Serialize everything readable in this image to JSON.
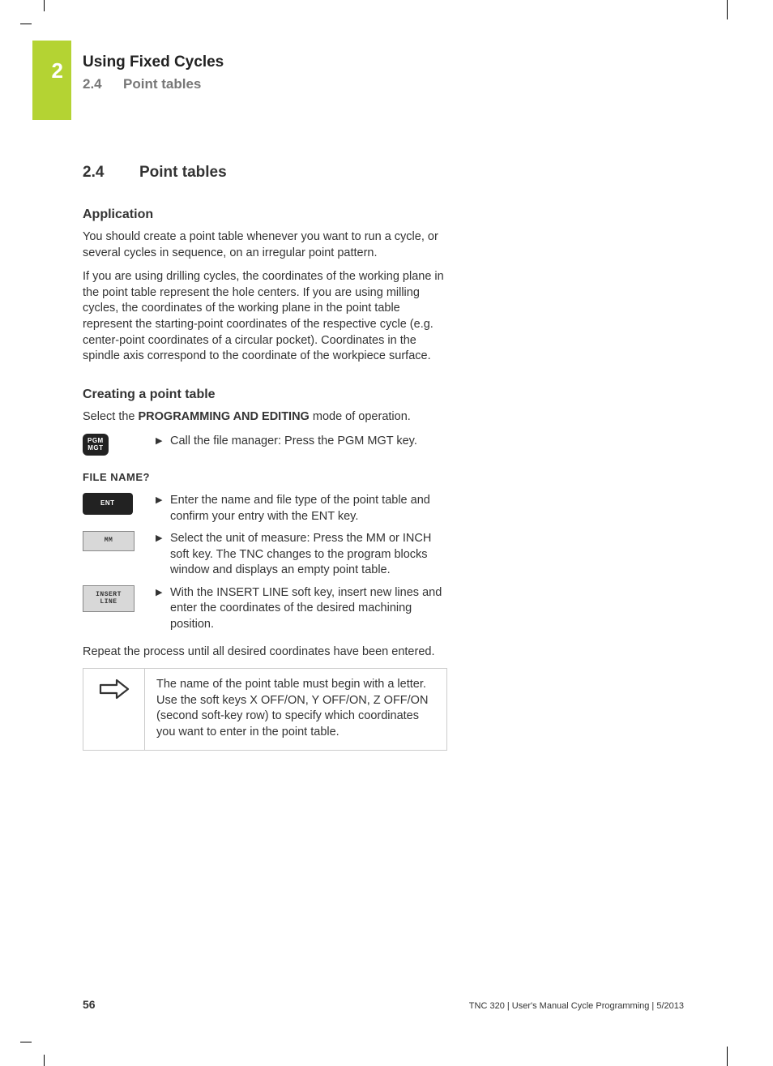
{
  "chapter": {
    "number": "2",
    "title": "Using Fixed Cycles"
  },
  "section_header": {
    "number": "2.4",
    "title": "Point tables"
  },
  "main_heading": {
    "number": "2.4",
    "title": "Point tables"
  },
  "application": {
    "heading": "Application",
    "p1": "You should create a point table whenever you want to run a cycle, or several cycles in sequence, on an irregular point pattern.",
    "p2": "If you are using drilling cycles, the coordinates of the working plane in the point table represent the hole centers. If you are using milling cycles, the coordinates of the working plane in the point table represent the starting-point coordinates of the respective cycle (e.g. center-point coordinates of a circular pocket). Coordinates in the spindle axis correspond to the coordinate of the workpiece surface."
  },
  "creating": {
    "heading": "Creating a point table",
    "intro_pre": "Select the ",
    "intro_bold": "PROGRAMMING AND EDITING",
    "intro_post": " mode of operation.",
    "step1": "Call the file manager: Press the PGM MGT key.",
    "prompt": "FILE NAME?",
    "step2": "Enter the name and file type of the point table and confirm your entry with the ENT key.",
    "step3": "Select the unit of measure: Press the MM or INCH soft key. The TNC changes to the program blocks window and displays an empty point table.",
    "step4": "With the INSERT LINE soft key, insert new lines and enter the coordinates of the desired machining position.",
    "repeat": "Repeat the process until all desired coordinates have been entered.",
    "note": "The name of the point table must begin with a letter. Use the soft keys X OFF/ON, Y OFF/ON, Z OFF/ON (second soft-key row) to specify which coordinates you want to enter in the point table."
  },
  "keys": {
    "pgm_mgt_l1": "PGM",
    "pgm_mgt_l2": "MGT",
    "ent": "ENT",
    "mm": "MM",
    "insert_l1": "INSERT",
    "insert_l2": "LINE"
  },
  "footer": {
    "page": "56",
    "text": "TNC 320 | User's Manual Cycle Programming | 5/2013"
  }
}
